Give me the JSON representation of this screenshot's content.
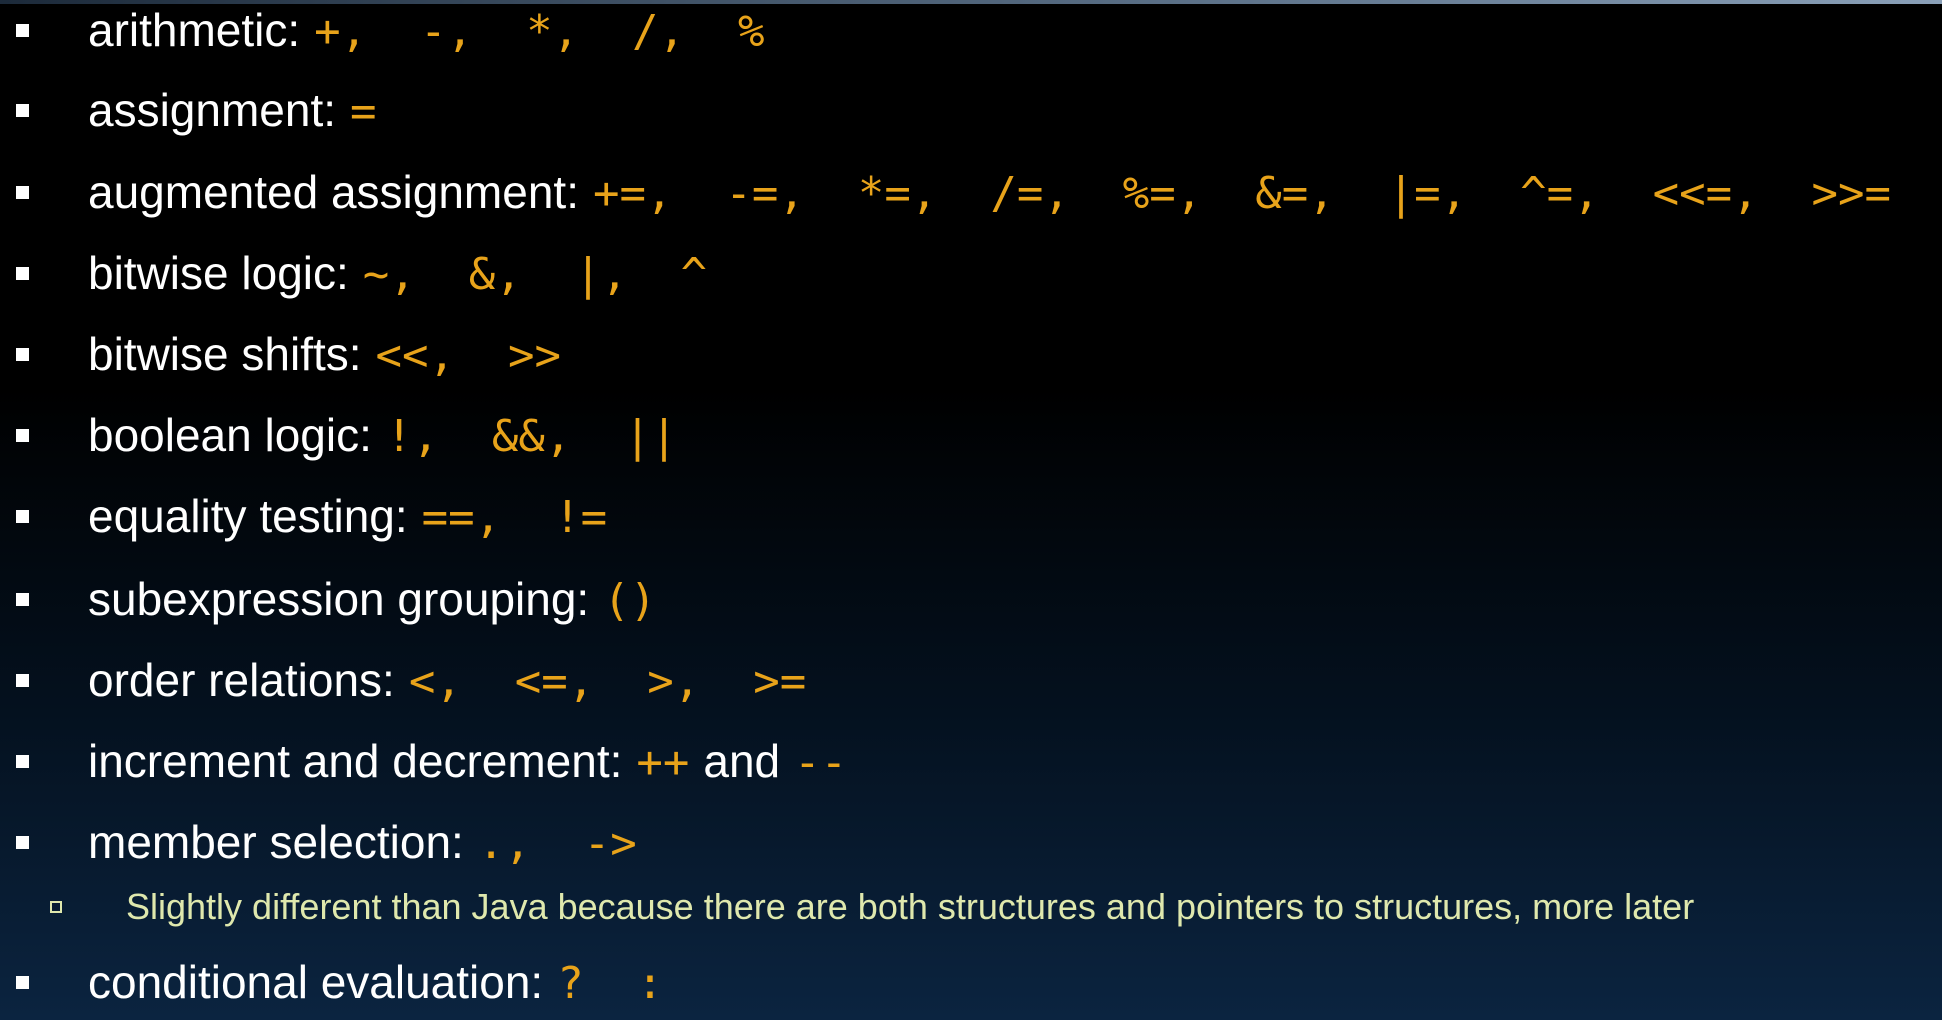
{
  "items": [
    {
      "label": "arithmetic:",
      "ops": "+,  -,  *,  /,  %"
    },
    {
      "label": "assignment:",
      "ops": "="
    },
    {
      "label": "augmented assignment:",
      "ops": "+=,  -=,  *=,  /=,  %=,  &=,  |=,  ^=,  <<=,  >>="
    },
    {
      "label": "bitwise logic:",
      "ops": "~,  &,  |,  ^"
    },
    {
      "label": "bitwise shifts:",
      "ops": "<<,  >>"
    },
    {
      "label": "boolean logic:",
      "ops": "!,  &&,  ||"
    },
    {
      "label": "equality testing:",
      "ops": "==,  !="
    },
    {
      "label": "subexpression grouping:",
      "ops": "()"
    },
    {
      "label": "order relations:",
      "ops": "<,  <=,  >,  >="
    },
    {
      "label": "increment and decrement:",
      "ops": "++",
      "mid": "and",
      "ops2": "--"
    },
    {
      "label": "member selection:",
      "ops": ".,  ->"
    },
    {
      "label": "conditional evaluation:",
      "ops": "?  :"
    }
  ],
  "subitem": {
    "text": "Slightly different than Java because there are both structures and pointers to structures, more later"
  },
  "colors": {
    "operator": "#e8a31a",
    "text": "#ffffff",
    "subtext": "#dfe8ad"
  }
}
